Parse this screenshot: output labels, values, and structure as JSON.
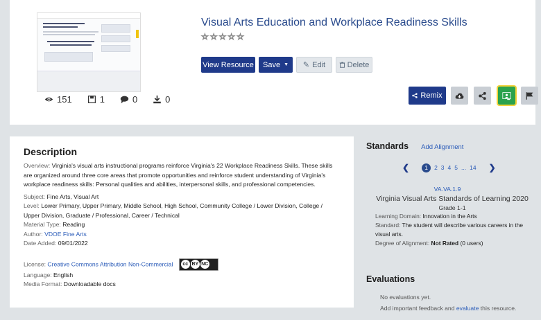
{
  "resource": {
    "title": "Visual Arts Education and Workplace Readiness Skills",
    "stars": [
      "☆",
      "☆",
      "☆",
      "☆",
      "☆"
    ],
    "stats": {
      "views": "151",
      "saves": "1",
      "comments": "0",
      "downloads": "0"
    }
  },
  "actions": {
    "view_label": "View Resource",
    "save_label": "Save",
    "edit_label": "Edit",
    "delete_label": "Delete",
    "remix_label": "Remix"
  },
  "icons": {
    "views": "eye-icon",
    "saves": "save-icon",
    "comments": "comment-icon",
    "downloads": "download-icon",
    "cloud": "cloud-download-icon",
    "share": "share-icon",
    "classroom": "google-classroom-icon",
    "flag": "flag-icon"
  },
  "description": {
    "heading": "Description",
    "overview_key": "Overview:",
    "overview": "Virginia's visual arts instructional programs reinforce Virginia's 22 Workplace Readiness Skills. These skills are organized around three core areas that promote opportunities and reinforce student understanding of Virginia's workplace readiness skills: Personal qualities and abilities, interpersonal skills, and professional competencies.",
    "subject_key": "Subject:",
    "subject": "Fine Arts, Visual Art",
    "level_key": "Level:",
    "level": "Lower Primary, Upper Primary, Middle School, High School, Community College / Lower Division, College / Upper Division, Graduate / Professional, Career / Technical",
    "material_key": "Material Type:",
    "material": "Reading",
    "author_key": "Author:",
    "author": "VDOE Fine Arts",
    "date_key": "Date Added:",
    "date": "09/01/2022",
    "license_key": "License:",
    "license": "Creative Commons Attribution Non-Commercial",
    "cc_badge": [
      "cc",
      "BY",
      "NC"
    ],
    "language_key": "Language:",
    "language": "English",
    "media_key": "Media Format:",
    "media": "Downloadable docs"
  },
  "standards": {
    "heading": "Standards",
    "add_label": "Add Alignment",
    "pages": [
      "1",
      "2",
      "3",
      "4",
      "5",
      "...",
      "14"
    ],
    "current_page": "1",
    "code": "VA.VA.1.9",
    "name": "Virginia Visual Arts Standards of Learning 2020",
    "grade": "Grade 1-1",
    "domain_key": "Learning Domain:",
    "domain": "Innovation in the Arts",
    "standard_key": "Standard:",
    "standard": "The student will describe various careers in the visual arts.",
    "degree_key": "Degree of Alignment:",
    "degree": "Not Rated",
    "degree_users": "(0 users)"
  },
  "evaluations": {
    "heading": "Evaluations",
    "none": "No evaluations yet.",
    "prompt_pre": "Add important feedback and",
    "prompt_link": "evaluate",
    "prompt_post": "this resource."
  }
}
